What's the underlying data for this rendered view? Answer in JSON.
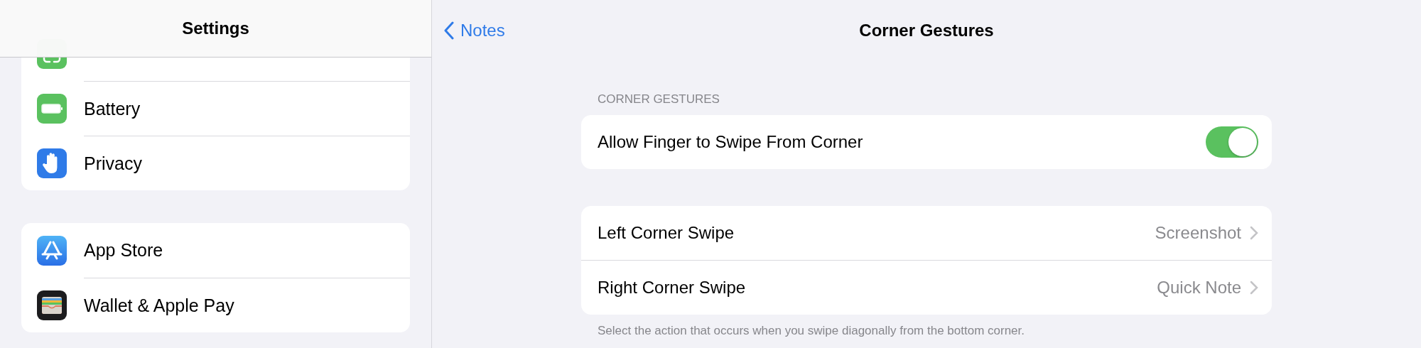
{
  "sidebar": {
    "title": "Settings",
    "groups": [
      [
        {
          "kind": "face-id"
        },
        {
          "kind": "battery",
          "label": "Battery"
        },
        {
          "kind": "privacy",
          "label": "Privacy"
        }
      ],
      [
        {
          "kind": "app-store",
          "label": "App Store"
        },
        {
          "kind": "wallet",
          "label": "Wallet & Apple Pay"
        }
      ]
    ]
  },
  "detail": {
    "back": "Notes",
    "title": "Corner Gestures",
    "section_header": "CORNER GESTURES",
    "toggle_row": {
      "label": "Allow Finger to Swipe From Corner",
      "on": true
    },
    "swipe_rows": [
      {
        "label": "Left Corner Swipe",
        "value": "Screenshot"
      },
      {
        "label": "Right Corner Swipe",
        "value": "Quick Note"
      }
    ],
    "footer": "Select the action that occurs when you swipe diagonally from the bottom corner."
  }
}
